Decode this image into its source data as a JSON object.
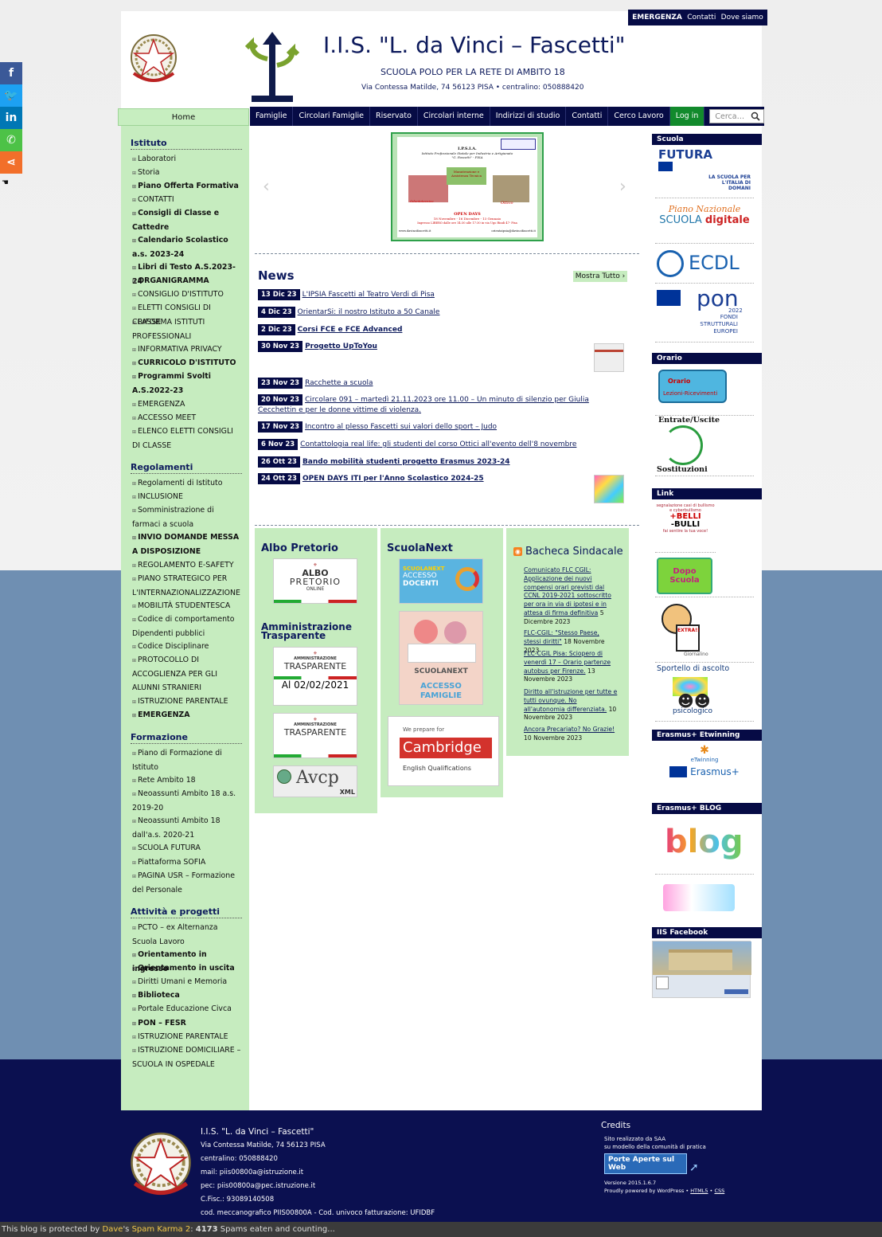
{
  "topnav": {
    "items": [
      "EMERGENZA",
      "Contatti",
      "Dove siamo"
    ]
  },
  "header": {
    "title": "I.I.S. \"L. da Vinci – Fascetti\"",
    "subtitle": "SCUOLA POLO PER LA RETE DI AMBITO 18",
    "address": "Via Contessa Matilde, 74 56123 PISA • centralino: 050888420",
    "crest_label": "REPUBBLICA ITALIANA"
  },
  "menu": {
    "home": "Home",
    "items": [
      "Famiglie",
      "Circolari Famiglie",
      "Riservato",
      "Circolari interne",
      "Indirizzi di studio",
      "Contatti",
      "Cerco Lavoro"
    ],
    "login": "Log in",
    "search_placeholder": "Cerca…"
  },
  "social": {
    "icons": [
      "facebook-icon",
      "twitter-icon",
      "linkedin-icon",
      "whatsapp-icon",
      "share-icon"
    ],
    "colors": [
      "#3b5998",
      "#1da1f2",
      "#0077b5",
      "#4dc247",
      "#f26f2a"
    ]
  },
  "sidebar": {
    "istituto_title": "Istituto",
    "istituto": [
      "Laboratori",
      "Storia",
      "Piano Offerta Formativa",
      "CONTATTI",
      "Consigli di Classe e Cattedre",
      "Calendario Scolastico a.s. 2023-24",
      "Libri di Testo A.S.2023-24",
      "ORGANIGRAMMA",
      "CONSIGLIO D'ISTITUTO",
      "ELETTI CONSIGLI DI CLASSE",
      "RIFORMA ISTITUTI PROFESSIONALI",
      "INFORMATIVA PRIVACY",
      "CURRICOLO D'ISTITUTO",
      "Programmi Svolti A.S.2022-23",
      "EMERGENZA",
      "ACCESSO MEET",
      "ELENCO ELETTI CONSIGLI DI CLASSE"
    ],
    "regolamenti_title": "Regolamenti",
    "regolamenti": [
      "Regolamenti di Istituto",
      "INCLUSIONE",
      "Somministrazione di farmaci a scuola",
      "INVIO DOMANDE MESSA A DISPOSIZIONE",
      "REGOLAMENTO E-SAFETY",
      "PIANO STRATEGICO PER L'INTERNAZIONALIZZAZIONE",
      "MOBILITÀ STUDENTESCA",
      "Codice di comportamento Dipendenti pubblici",
      "Codice Disciplinare",
      "PROTOCOLLO DI ACCOGLIENZA PER GLI ALUNNI STRANIERI",
      "ISTRUZIONE PARENTALE",
      "EMERGENZA"
    ],
    "formazione_title": "Formazione",
    "formazione": [
      "Piano di Formazione di Istituto",
      "Rete Ambito 18",
      "Neoassunti Ambito 18 a.s. 2019-20",
      "Neoassunti Ambito 18 dall'a.s. 2020-21",
      "SCUOLA FUTURA",
      "Piattaforma SOFIA",
      "PAGINA USR – Formazione del Personale"
    ],
    "attivita_title": "Attività e progetti",
    "attivita": [
      "PCTO – ex Alternanza Scuola Lavoro",
      "Orientamento in ingresso",
      "Orientamento in uscita",
      "Diritti Umani e Memoria",
      "Biblioteca",
      "Portale Educazione Civca",
      "PON – FESR",
      "ISTRUZIONE PARENTALE",
      "ISTRUZIONE DOMICILIARE – SCUOLA IN OSPEDALE"
    ]
  },
  "slider": {
    "school": "I.P.S.I.A.",
    "line1": "Istituto Professionale Statale per Industria e Artigianato",
    "line2": "\"G. Fascetti\" - PISA",
    "box1": "Manutenzione e Assistenza Tecnica",
    "box2": "Odontotecnico",
    "box3": "Ottico",
    "open": "OPEN DAYS",
    "dates": "18 Novembre - 16 Dicembre - 13 Gennaio",
    "entry": "Ingresso LIBERO dalle ore 14:30 alle 17:30 in via Ugo Rindi 47- Pisa",
    "site": "www.davincifascetti.it",
    "email": "orientaipsia@davincifascetti.it"
  },
  "news": {
    "title": "News",
    "show_all": "Mostra Tutto ›",
    "items": [
      {
        "date": "13 Dic 23",
        "text": "L'IPSIA Fascetti al Teatro Verdi di Pisa",
        "bold": false
      },
      {
        "date": "4 Dic 23",
        "text": "OrientarSi: il nostro Istituto a 50 Canale",
        "bold": false
      },
      {
        "date": "2 Dic 23",
        "text": "Corsi FCE e FCE Advanced",
        "bold": true
      },
      {
        "date": "30 Nov 23",
        "text": "Progetto UpToYou",
        "bold": true
      },
      {
        "date": "23 Nov 23",
        "text": "Racchette a scuola",
        "bold": false
      },
      {
        "date": "20 Nov 23",
        "text": "Circolare 091 – martedì 21.11.2023 ore 11.00 – Un minuto di silenzio per Giulia Cecchettin e per le donne vittime di violenza.",
        "bold": false
      },
      {
        "date": "17 Nov 23",
        "text": "Incontro al plesso Fascetti sui valori dello sport – Judo",
        "bold": false
      },
      {
        "date": "6 Nov 23",
        "text": "Contattologia real life: gli studenti del corso Ottici all'evento dell'8 novembre",
        "bold": false
      },
      {
        "date": "26 Ott 23",
        "text": "Bando mobilità studenti progetto Erasmus 2023-24",
        "bold": true
      },
      {
        "date": "24 Ott 23",
        "text": "OPEN DAYS ITI per l'Anno Scolastico 2024-25",
        "bold": true
      }
    ]
  },
  "widgets": {
    "albo_title": "Albo Pretorio",
    "albo_l1": "ALBO",
    "albo_l2": "PRETORIO",
    "albo_l3": "ONLINE",
    "amm_title": "Amministrazione Trasparente",
    "amm_l1": "AMMINISTRAZIONE",
    "amm_l2": "TRASPARENTE",
    "amm_date": "Al 02/02/2021",
    "avcp": "Avcp",
    "avcp_xml": "XML",
    "sn_title": "ScuolaNext",
    "sn_brand": "SCUOLANEXT",
    "sn_access": "ACCESSO",
    "sn_docenti": "DOCENTI",
    "sn_famiglie": "ACCESSO FAMIGLIE",
    "cam_pre": "We prepare for",
    "cam_name": "Cambridge",
    "cam_sub": "English Qualifications",
    "bacheca_title": "Bacheca Sindacale"
  },
  "bacheca": [
    {
      "link": "Comunicato FLC CGIL: Applicazione dei nuovi compensi orari previsti dal CCNL 2019-2021 sottoscritto per ora in via di ipotesi e in attesa di firma definitiva",
      "date": "5 Dicembre 2023"
    },
    {
      "link": "FLC-CGIL: \"Stesso Paese, stessi diritti\"",
      "date": "18 Novembre 2023"
    },
    {
      "link": "FLC-CGIL Pisa: Sciopero di venerdì 17 – Orario partenze autobus per Firenze.",
      "date": "13 Novembre 2023"
    },
    {
      "link": "Diritto all'istruzione per tutte e tutti ovunque. No all'autonomia differenziata.",
      "date": "10 Novembre 2023"
    },
    {
      "link": "Ancora Precariato? No Grazie!",
      "date": "10 Novembre 2023"
    }
  ],
  "right": {
    "scuola": "Scuola",
    "futura": "FUTURA",
    "futura_sub": "LA SCUOLA PER L'ITALIA DI DOMANI",
    "pnsd1": "Piano Nazionale",
    "pnsd2": "SCUOLA",
    "pnsd3": "digitale",
    "ecdl": "ECDL",
    "pon": "pon",
    "pon_year": "2022",
    "pon_sub": "FONDI STRUTTURALI EUROPEI",
    "orario": "Orario",
    "orario_btn1": "Orario",
    "orario_btn2": "Lezioni-Ricevimenti",
    "entrate": "Entrate/Uscite",
    "sostituzioni": "Sostituzioni",
    "link": "Link",
    "bulli_top": "segnalazione casi di bullismo e cyberbullismo",
    "bulli1": "+BELLI",
    "bulli2": "-BULLI",
    "bulli_bot": "fai sentire la tua voce!",
    "dopo": "Dopo Scuola",
    "giornalino_badge": "EXTRA!!",
    "giornalino": "Giornalino",
    "sportello": "Sportello di ascolto",
    "psicologico": "psicologico",
    "erasmus_head": "Erasmus+ Etwinning",
    "etwinning": "eTwinning",
    "erasmus": "Erasmus+",
    "blog_head": "Erasmus+ BLOG",
    "blog": "blog",
    "fb_head": "IIS Facebook"
  },
  "footer": {
    "name": "I.I.S. \"L. da Vinci – Fascetti\"",
    "address": "Via Contessa Matilde, 74 56123 PISA",
    "phone": "centralino: 050888420",
    "mail": "mail: piis00800a@istruzione.it",
    "pec": "pec: piis00800a@pec.istruzione.it",
    "cf": "C.Fisc.: 93089140508",
    "mecc": "cod. meccanografico PIIS00800A - Cod. univoco fatturazione: UFIDBF",
    "credits_title": "Credits",
    "credits1": "Sito realizzato da SAA",
    "credits2": "su modello della comunità di pratica",
    "pa_badge": "Porte Aperte sul Web",
    "version": "Versione 2015.1.6.7",
    "powered": "Proudly powered by WordPress •",
    "html5": "HTML5",
    "css": "CSS"
  },
  "spam": {
    "pre": "This blog is protected by ",
    "dave": "Dave",
    "mid": "'s ",
    "sk": "Spam Karma 2",
    "colon": ": ",
    "count": "4173",
    "post": " Spams eaten and counting..."
  }
}
